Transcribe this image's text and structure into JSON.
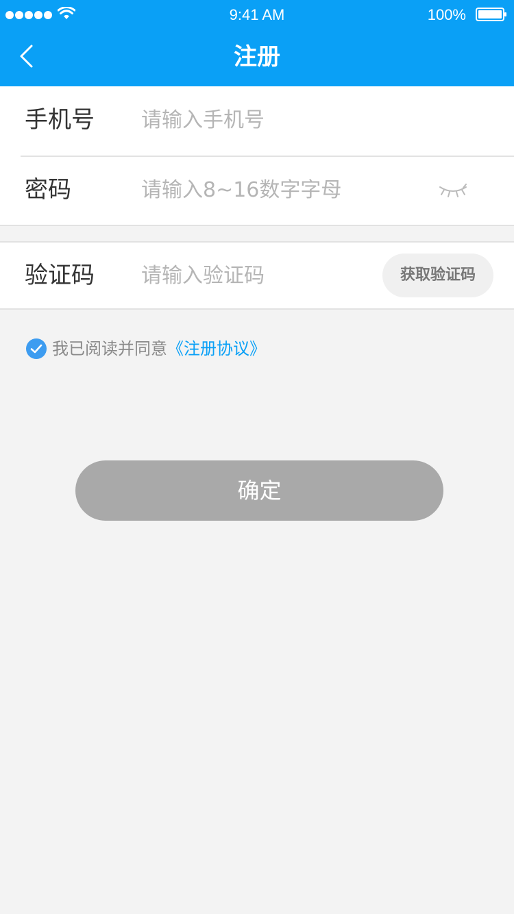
{
  "status_bar": {
    "time": "9:41 AM",
    "battery": "100%"
  },
  "nav": {
    "title": "注册"
  },
  "form": {
    "phone": {
      "label": "手机号",
      "value": "",
      "placeholder": "请输入手机号"
    },
    "password": {
      "label": "密码",
      "value": "",
      "placeholder": "请输入8~16数字字母"
    },
    "code": {
      "label": "验证码",
      "value": "",
      "placeholder": "请输入验证码",
      "button_label": "获取验证码"
    }
  },
  "agreement": {
    "checked": true,
    "text": "我已阅读并同意",
    "link": "《注册协议》"
  },
  "confirm": {
    "label": "确定"
  },
  "colors": {
    "brand": "#0aa0f6",
    "background": "#f3f3f3",
    "button_disabled": "#a9a9a9",
    "check": "#3d9cf0"
  },
  "icons": {
    "back": "chevron-left-icon",
    "eye": "eye-closed-icon",
    "check": "check-circle-icon",
    "wifi": "wifi-icon",
    "battery": "battery-icon",
    "signal": "signal-icon"
  }
}
